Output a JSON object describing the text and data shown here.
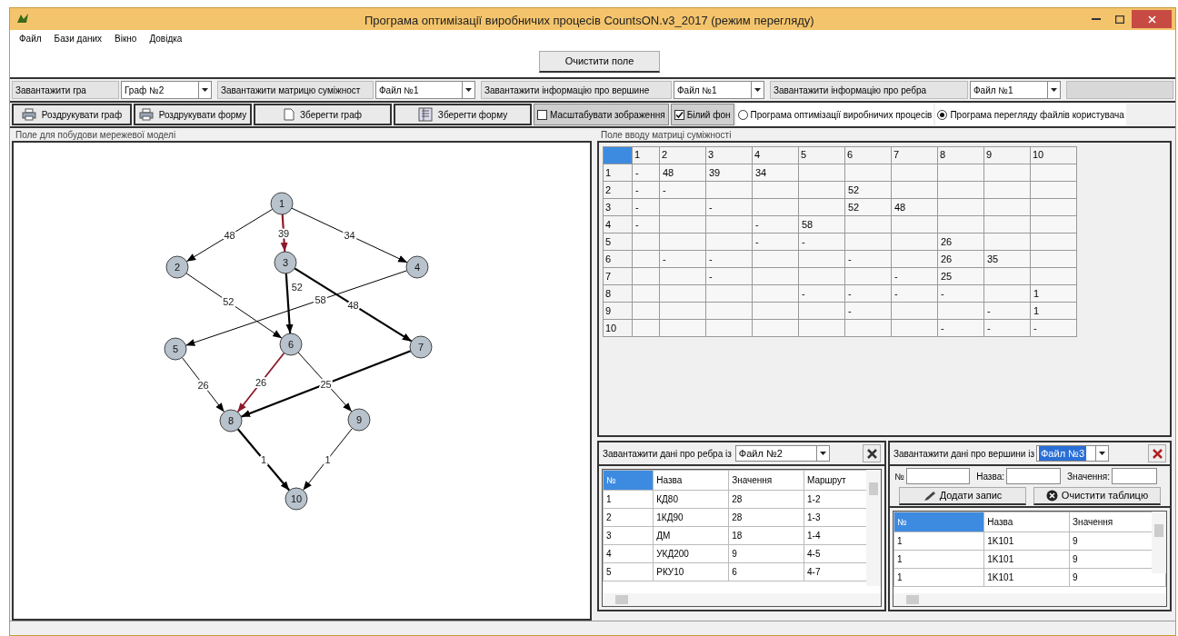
{
  "window": {
    "title": "Програма оптимізації виробничих процесів CountsON.v3_2017 (режим перегляду)"
  },
  "menu": [
    "Файл",
    "Бази даних",
    "Вікно",
    "Довідка"
  ],
  "clear_field_button": "Очистити поле",
  "load_bar": [
    {
      "label": "Завантажити гра",
      "value": "Граф №2"
    },
    {
      "label": "Завантажити матрицю суміжност",
      "value": "Файл №1"
    },
    {
      "label": "Завантажити інформацію про вершине",
      "value": "Файл №1"
    },
    {
      "label": "Завантажити інформацію про ребра",
      "value": "Файл №1"
    }
  ],
  "toolbar": [
    {
      "kind": "button",
      "label": "Роздрукувати граф"
    },
    {
      "kind": "button",
      "label": "Роздрукувати форму"
    },
    {
      "kind": "button",
      "label": "Зберегти граф"
    },
    {
      "kind": "button",
      "label": "Зберегти форму"
    },
    {
      "kind": "checkbox",
      "label": "Масштабувати зображення",
      "checked": false
    },
    {
      "kind": "checkbox",
      "label": "Білий фон",
      "checked": true
    },
    {
      "kind": "radio",
      "label": "Програма оптимізації виробничих процесів",
      "selected": false
    },
    {
      "kind": "radio",
      "label": "Програма перегляду файлів користувача",
      "selected": true
    }
  ],
  "graph_panel": {
    "title": "Поле для побудови мережевої моделі",
    "nodes": [
      "1",
      "2",
      "3",
      "4",
      "5",
      "6",
      "7",
      "8",
      "9",
      "10"
    ],
    "edges": [
      {
        "label": "48",
        "highlighted": false,
        "critical": false
      },
      {
        "label": "39",
        "highlighted": true,
        "critical": true
      },
      {
        "label": "34",
        "highlighted": false,
        "critical": false
      },
      {
        "label": "52",
        "highlighted": false,
        "critical": false
      },
      {
        "label": "52",
        "highlighted": false,
        "critical": true
      },
      {
        "label": "58",
        "highlighted": false,
        "critical": false
      },
      {
        "label": "48",
        "highlighted": false,
        "critical": true
      },
      {
        "label": "26",
        "highlighted": false,
        "critical": false
      },
      {
        "label": "26",
        "highlighted": true,
        "critical": false
      },
      {
        "highlighted": false,
        "critical": false
      },
      {
        "label": "25",
        "highlighted": false,
        "critical": true
      },
      {
        "label": "1",
        "highlighted": false,
        "critical": true
      },
      {
        "label": "1",
        "highlighted": false,
        "critical": false
      }
    ]
  },
  "matrix_panel": {
    "title": "Поле вводу матриці суміжності",
    "columns": [
      "1",
      "2",
      "3",
      "4",
      "5",
      "6",
      "7",
      "8",
      "9",
      "10"
    ],
    "rows": [
      {
        "header": "1",
        "cells": [
          "-",
          "48",
          "39",
          "34",
          null,
          null,
          null,
          null,
          null,
          null
        ]
      },
      {
        "header": "2",
        "cells": [
          "-",
          "-",
          null,
          null,
          null,
          "52",
          null,
          null,
          null,
          null
        ]
      },
      {
        "header": "3",
        "cells": [
          "-",
          null,
          "-",
          null,
          null,
          "52",
          "48",
          null,
          null,
          null
        ]
      },
      {
        "header": "4",
        "cells": [
          "-",
          null,
          null,
          "-",
          "58",
          null,
          null,
          null,
          null,
          null
        ]
      },
      {
        "header": "5",
        "cells": [
          null,
          null,
          null,
          "-",
          "-",
          null,
          null,
          "26",
          null,
          null
        ]
      },
      {
        "header": "6",
        "cells": [
          null,
          "-",
          "-",
          null,
          null,
          "-",
          null,
          "26",
          "35",
          null
        ]
      },
      {
        "header": "7",
        "cells": [
          null,
          null,
          "-",
          null,
          null,
          null,
          "-",
          "25",
          null,
          null
        ]
      },
      {
        "header": "8",
        "cells": [
          null,
          null,
          null,
          null,
          "-",
          "-",
          "-",
          "-",
          null,
          "1"
        ]
      },
      {
        "header": "9",
        "cells": [
          null,
          null,
          null,
          null,
          null,
          "-",
          null,
          null,
          "-",
          "1"
        ]
      },
      {
        "header": "10",
        "cells": [
          null,
          null,
          null,
          null,
          null,
          null,
          null,
          "-",
          "-",
          "-"
        ]
      }
    ]
  },
  "edges_panel": {
    "load_label": "Завантажити дані про ребра із",
    "file": "Файл №2",
    "columns": [
      "№",
      "Назва",
      "Значення",
      "Маршрут"
    ],
    "rows": [
      [
        "1",
        "КД80",
        "28",
        "1-2"
      ],
      [
        "2",
        "1КД90",
        "28",
        "1-3"
      ],
      [
        "3",
        "ДМ",
        "18",
        "1-4"
      ],
      [
        "4",
        "УКД200",
        "9",
        "4-5"
      ],
      [
        "5",
        "РКУ10",
        "6",
        "4-7"
      ]
    ]
  },
  "vertices_panel": {
    "load_label": "Завантажити дані про вершини із",
    "file": "Файл №3",
    "file_selected": true,
    "fields": [
      "№",
      "Назва:",
      "Значення:"
    ],
    "add_button": "Додати запис",
    "clear_button": "Очистити таблицю",
    "columns": [
      "№",
      "Назва",
      "Значення"
    ],
    "rows": [
      [
        "1",
        "1K101",
        "9"
      ],
      [
        "1",
        "1K101",
        "9"
      ],
      [
        "1",
        "1K101",
        "9"
      ]
    ]
  }
}
